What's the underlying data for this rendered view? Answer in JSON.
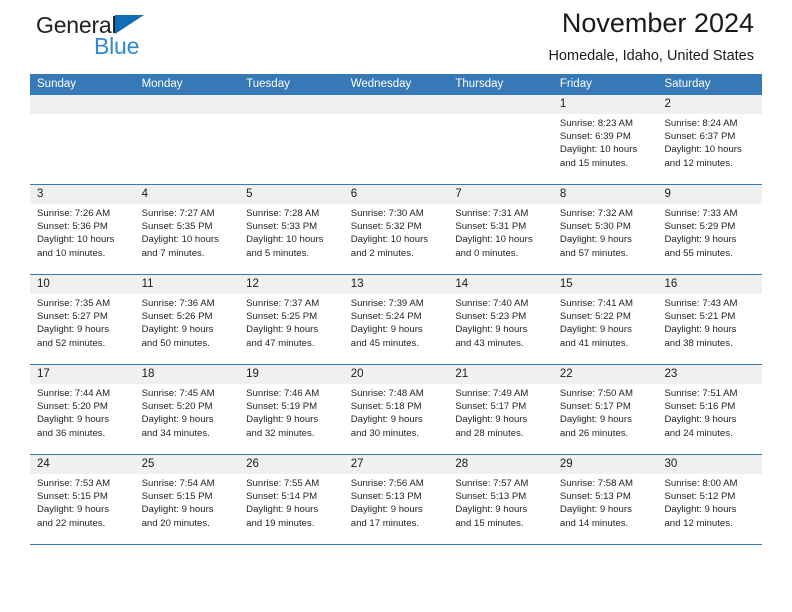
{
  "brand": {
    "name_dark": "General",
    "name_light": "Blue",
    "accent": "#2f88d4",
    "triangle_color": "#0f6cb5"
  },
  "header": {
    "title": "November 2024",
    "location": "Homedale, Idaho, United States",
    "header_bg": "#3679b6",
    "day_band_bg": "#f0f0f0"
  },
  "weekdays": [
    "Sunday",
    "Monday",
    "Tuesday",
    "Wednesday",
    "Thursday",
    "Friday",
    "Saturday"
  ],
  "weeks": [
    [
      {
        "day": "",
        "empty": true
      },
      {
        "day": "",
        "empty": true
      },
      {
        "day": "",
        "empty": true
      },
      {
        "day": "",
        "empty": true
      },
      {
        "day": "",
        "empty": true
      },
      {
        "day": "1",
        "sunrise": "Sunrise: 8:23 AM",
        "sunset": "Sunset: 6:39 PM",
        "daylight": "Daylight: 10 hours and 15 minutes."
      },
      {
        "day": "2",
        "sunrise": "Sunrise: 8:24 AM",
        "sunset": "Sunset: 6:37 PM",
        "daylight": "Daylight: 10 hours and 12 minutes."
      }
    ],
    [
      {
        "day": "3",
        "sunrise": "Sunrise: 7:26 AM",
        "sunset": "Sunset: 5:36 PM",
        "daylight": "Daylight: 10 hours and 10 minutes."
      },
      {
        "day": "4",
        "sunrise": "Sunrise: 7:27 AM",
        "sunset": "Sunset: 5:35 PM",
        "daylight": "Daylight: 10 hours and 7 minutes."
      },
      {
        "day": "5",
        "sunrise": "Sunrise: 7:28 AM",
        "sunset": "Sunset: 5:33 PM",
        "daylight": "Daylight: 10 hours and 5 minutes."
      },
      {
        "day": "6",
        "sunrise": "Sunrise: 7:30 AM",
        "sunset": "Sunset: 5:32 PM",
        "daylight": "Daylight: 10 hours and 2 minutes."
      },
      {
        "day": "7",
        "sunrise": "Sunrise: 7:31 AM",
        "sunset": "Sunset: 5:31 PM",
        "daylight": "Daylight: 10 hours and 0 minutes."
      },
      {
        "day": "8",
        "sunrise": "Sunrise: 7:32 AM",
        "sunset": "Sunset: 5:30 PM",
        "daylight": "Daylight: 9 hours and 57 minutes."
      },
      {
        "day": "9",
        "sunrise": "Sunrise: 7:33 AM",
        "sunset": "Sunset: 5:29 PM",
        "daylight": "Daylight: 9 hours and 55 minutes."
      }
    ],
    [
      {
        "day": "10",
        "sunrise": "Sunrise: 7:35 AM",
        "sunset": "Sunset: 5:27 PM",
        "daylight": "Daylight: 9 hours and 52 minutes."
      },
      {
        "day": "11",
        "sunrise": "Sunrise: 7:36 AM",
        "sunset": "Sunset: 5:26 PM",
        "daylight": "Daylight: 9 hours and 50 minutes."
      },
      {
        "day": "12",
        "sunrise": "Sunrise: 7:37 AM",
        "sunset": "Sunset: 5:25 PM",
        "daylight": "Daylight: 9 hours and 47 minutes."
      },
      {
        "day": "13",
        "sunrise": "Sunrise: 7:39 AM",
        "sunset": "Sunset: 5:24 PM",
        "daylight": "Daylight: 9 hours and 45 minutes."
      },
      {
        "day": "14",
        "sunrise": "Sunrise: 7:40 AM",
        "sunset": "Sunset: 5:23 PM",
        "daylight": "Daylight: 9 hours and 43 minutes."
      },
      {
        "day": "15",
        "sunrise": "Sunrise: 7:41 AM",
        "sunset": "Sunset: 5:22 PM",
        "daylight": "Daylight: 9 hours and 41 minutes."
      },
      {
        "day": "16",
        "sunrise": "Sunrise: 7:43 AM",
        "sunset": "Sunset: 5:21 PM",
        "daylight": "Daylight: 9 hours and 38 minutes."
      }
    ],
    [
      {
        "day": "17",
        "sunrise": "Sunrise: 7:44 AM",
        "sunset": "Sunset: 5:20 PM",
        "daylight": "Daylight: 9 hours and 36 minutes."
      },
      {
        "day": "18",
        "sunrise": "Sunrise: 7:45 AM",
        "sunset": "Sunset: 5:20 PM",
        "daylight": "Daylight: 9 hours and 34 minutes."
      },
      {
        "day": "19",
        "sunrise": "Sunrise: 7:46 AM",
        "sunset": "Sunset: 5:19 PM",
        "daylight": "Daylight: 9 hours and 32 minutes."
      },
      {
        "day": "20",
        "sunrise": "Sunrise: 7:48 AM",
        "sunset": "Sunset: 5:18 PM",
        "daylight": "Daylight: 9 hours and 30 minutes."
      },
      {
        "day": "21",
        "sunrise": "Sunrise: 7:49 AM",
        "sunset": "Sunset: 5:17 PM",
        "daylight": "Daylight: 9 hours and 28 minutes."
      },
      {
        "day": "22",
        "sunrise": "Sunrise: 7:50 AM",
        "sunset": "Sunset: 5:17 PM",
        "daylight": "Daylight: 9 hours and 26 minutes."
      },
      {
        "day": "23",
        "sunrise": "Sunrise: 7:51 AM",
        "sunset": "Sunset: 5:16 PM",
        "daylight": "Daylight: 9 hours and 24 minutes."
      }
    ],
    [
      {
        "day": "24",
        "sunrise": "Sunrise: 7:53 AM",
        "sunset": "Sunset: 5:15 PM",
        "daylight": "Daylight: 9 hours and 22 minutes."
      },
      {
        "day": "25",
        "sunrise": "Sunrise: 7:54 AM",
        "sunset": "Sunset: 5:15 PM",
        "daylight": "Daylight: 9 hours and 20 minutes."
      },
      {
        "day": "26",
        "sunrise": "Sunrise: 7:55 AM",
        "sunset": "Sunset: 5:14 PM",
        "daylight": "Daylight: 9 hours and 19 minutes."
      },
      {
        "day": "27",
        "sunrise": "Sunrise: 7:56 AM",
        "sunset": "Sunset: 5:13 PM",
        "daylight": "Daylight: 9 hours and 17 minutes."
      },
      {
        "day": "28",
        "sunrise": "Sunrise: 7:57 AM",
        "sunset": "Sunset: 5:13 PM",
        "daylight": "Daylight: 9 hours and 15 minutes."
      },
      {
        "day": "29",
        "sunrise": "Sunrise: 7:58 AM",
        "sunset": "Sunset: 5:13 PM",
        "daylight": "Daylight: 9 hours and 14 minutes."
      },
      {
        "day": "30",
        "sunrise": "Sunrise: 8:00 AM",
        "sunset": "Sunset: 5:12 PM",
        "daylight": "Daylight: 9 hours and 12 minutes."
      }
    ]
  ]
}
